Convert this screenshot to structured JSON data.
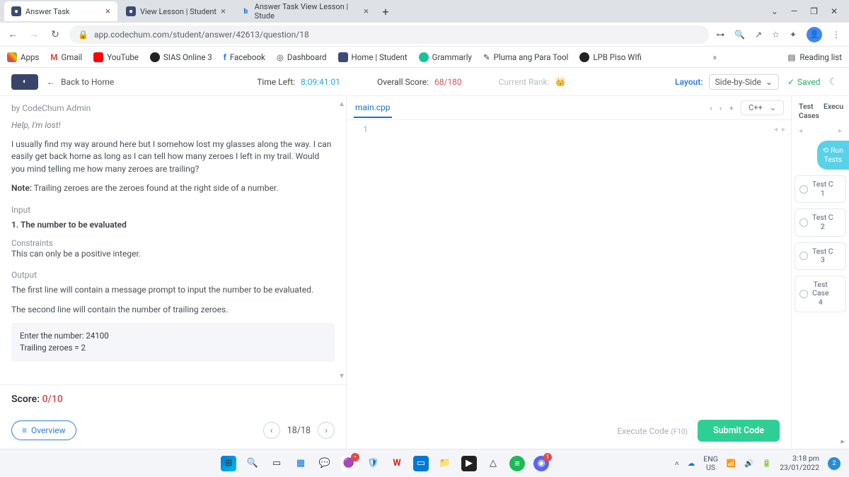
{
  "browser": {
    "tabs": [
      {
        "title": "Answer Task"
      },
      {
        "title": "View Lesson | Student"
      },
      {
        "title": "Answer Task View Lesson | Stude"
      }
    ],
    "url": "app.codechum.com/student/answer/42613/question/18",
    "bookmarks": [
      "Apps",
      "Gmail",
      "YouTube",
      "SIAS Online 3",
      "Facebook",
      "Dashboard",
      "Home | Student",
      "Grammarly",
      "Pluma ang Para Tool",
      "LPB Piso WIfi"
    ],
    "reading_list": "Reading list"
  },
  "header": {
    "back": "Back to Home",
    "time_label": "Time Left:",
    "time_value": "8:09:41:01",
    "score_label": "Overall Score:",
    "score_value": "68/180",
    "rank_label": "Current Rank:",
    "layout_label": "Layout:",
    "layout_value": "Side-by-Side",
    "saved": "Saved"
  },
  "problem": {
    "author": "by CodeChum Admin",
    "help": "Help, I'm lost!",
    "p1": "I usually find my way around here but I somehow lost my glasses along the way. I can easily get back home as long as I can tell how many zeroes I left in my trail. Would you mind telling me how many zeroes are trailing?",
    "note_label": "Note:",
    "note_text": " Trailing zeroes are the zeroes found at the right side of a number.",
    "input_title": "Input",
    "input_1": "1. The number to be evaluated",
    "constraints_label": "Constraints",
    "constraints_text": "This can only be a positive integer.",
    "output_title": "Output",
    "output_l1": "The first line will contain a message prompt to input the number to be evaluated.",
    "output_l2": "The second line will contain the number of trailing zeroes.",
    "example_l1": "Enter the number: 24100",
    "example_l2": "Trailing zeroes = 2"
  },
  "score": {
    "label": "Score: ",
    "value": "0/10"
  },
  "footer_left": {
    "overview": "Overview",
    "page": "18/18"
  },
  "editor": {
    "filename": "main.cpp",
    "lang": "C++",
    "line1": "1"
  },
  "footer_mid": {
    "execute": "Execute Code ",
    "execute_hint": "(F10)",
    "submit": "Submit Code"
  },
  "right": {
    "head1": "Test Cases",
    "head2": "Execu",
    "run1": "Run",
    "run2": "Tests",
    "cases": [
      {
        "l1": "Test C",
        "l2": "1"
      },
      {
        "l1": "Test C",
        "l2": "2"
      },
      {
        "l1": "Test C",
        "l2": "3"
      },
      {
        "l1": "Test",
        "l2": "Case",
        "l3": "4"
      }
    ]
  },
  "taskbar": {
    "lang1": "ENG",
    "lang2": "US",
    "time": "3:18 pm",
    "date": "23/01/2022",
    "notif": "2"
  }
}
